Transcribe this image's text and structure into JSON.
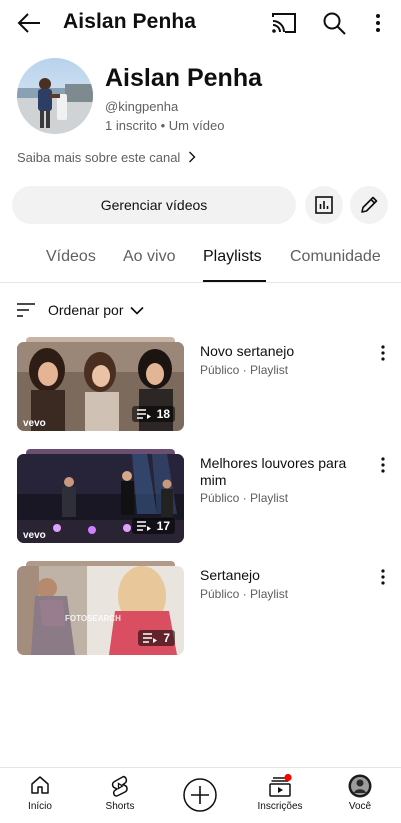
{
  "header": {
    "title": "Aislan Penha",
    "icons": [
      "back-arrow-icon",
      "cast-icon",
      "search-icon",
      "more-vertical-icon"
    ]
  },
  "channel": {
    "name": "Aislan Penha",
    "handle": "@kingpenha",
    "meta": "1 inscrito • Um vídeo",
    "more_about": "Saiba mais sobre este canal"
  },
  "actions": {
    "manage_label": "Gerenciar vídeos",
    "icons": [
      "analytics-icon",
      "edit-pencil-icon"
    ]
  },
  "tabs": [
    {
      "label": "Vídeos",
      "active": false
    },
    {
      "label": "Ao vivo",
      "active": false
    },
    {
      "label": "Playlists",
      "active": true
    },
    {
      "label": "Comunidade",
      "active": false
    }
  ],
  "sort": {
    "label": "Ordenar por"
  },
  "playlists": [
    {
      "title": "Novo sertanejo",
      "subtitle": "Público · Playlist",
      "count": "18",
      "thumb_label": "vevo"
    },
    {
      "title": "Melhores louvores para mim",
      "subtitle": "Público · Playlist",
      "count": "17",
      "thumb_label": "vevo"
    },
    {
      "title": "Sertanejo",
      "subtitle": "Público · Playlist",
      "count": "7",
      "thumb_label": "FOTOSEARCH"
    }
  ],
  "bottom_nav": [
    {
      "label": "Início",
      "icon": "home-icon"
    },
    {
      "label": "Shorts",
      "icon": "shorts-icon"
    },
    {
      "label": "",
      "icon": "create-plus-icon"
    },
    {
      "label": "Inscrições",
      "icon": "subscriptions-icon",
      "notification_dot": true
    },
    {
      "label": "Você",
      "icon": "profile-avatar-icon"
    }
  ],
  "colors": {
    "text_primary": "#0f0f0f",
    "text_secondary": "#606060",
    "button_bg": "#f2f2f2",
    "notification_red": "#ff0000"
  }
}
